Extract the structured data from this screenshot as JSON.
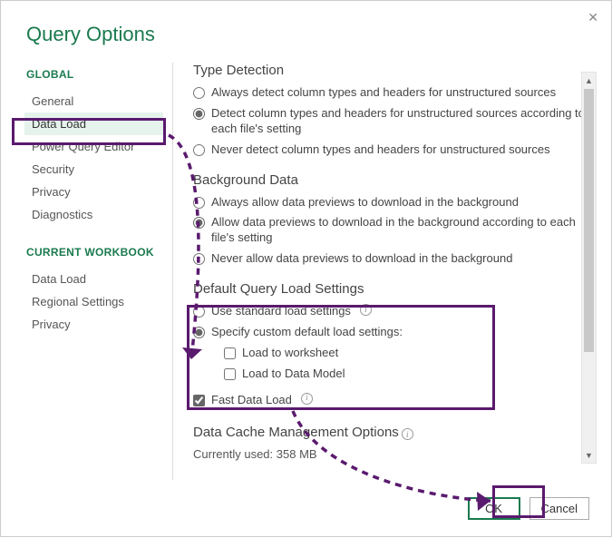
{
  "title": "Query Options",
  "sidebar": {
    "global_heading": "GLOBAL",
    "global_items": [
      "General",
      "Data Load",
      "Power Query Editor",
      "Security",
      "Privacy",
      "Diagnostics"
    ],
    "current_heading": "CURRENT WORKBOOK",
    "current_items": [
      "Data Load",
      "Regional Settings",
      "Privacy"
    ]
  },
  "type_detection": {
    "heading": "Type Detection",
    "opt1": "Always detect column types and headers for unstructured sources",
    "opt2": "Detect column types and headers for unstructured sources according to each file's setting",
    "opt3": "Never detect column types and headers for unstructured sources",
    "selected": 1
  },
  "background_data": {
    "heading": "Background Data",
    "opt1": "Always allow data previews to download in the background",
    "opt2": "Allow data previews to download in the background according to each file's setting",
    "opt3": "Never allow data previews to download in the background",
    "selected": 1
  },
  "default_load": {
    "heading": "Default Query Load Settings",
    "opt1": "Use standard load settings",
    "opt2": "Specify custom default load settings:",
    "chk1": "Load to worksheet",
    "chk2": "Load to Data Model",
    "selected": 1
  },
  "fast_load": "Fast Data Load",
  "cache": {
    "heading": "Data Cache Management Options",
    "used_label": "Currently used: 358 MB"
  },
  "footer": {
    "ok": "OK",
    "cancel": "Cancel"
  }
}
